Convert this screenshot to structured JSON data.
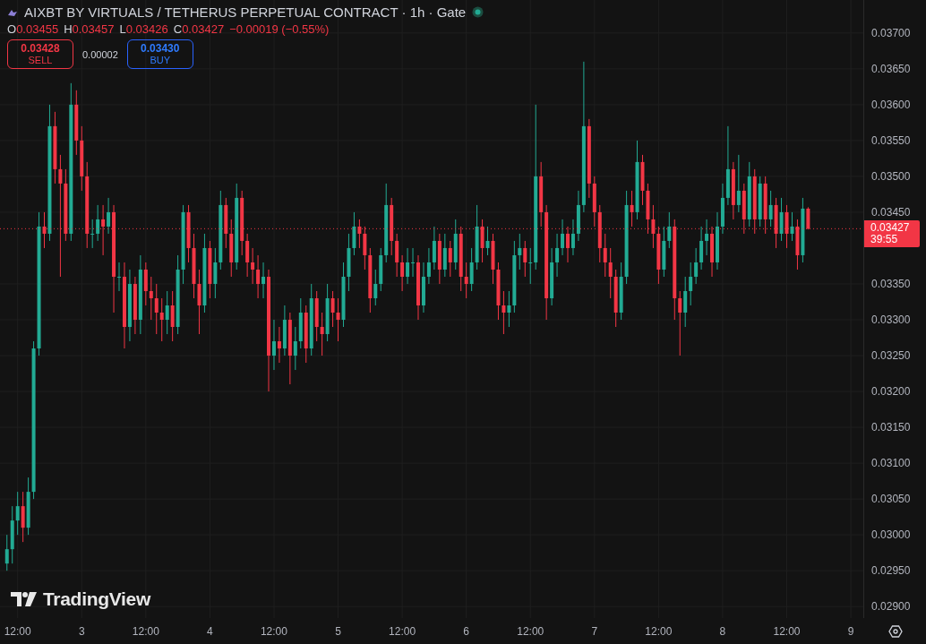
{
  "legend": {
    "title": "AIXBT BY VIRTUALS / TETHERUS PERPETUAL CONTRACT · 1h · Gate",
    "ohlc": [
      {
        "label": "O",
        "value": "0.03455"
      },
      {
        "label": "H",
        "value": "0.03457"
      },
      {
        "label": "L",
        "value": "0.03426"
      },
      {
        "label": "C",
        "value": "0.03427"
      }
    ],
    "change": "−0.00019 (−0.55%)",
    "trade": {
      "sell": {
        "price": "0.03428",
        "label": "SELL"
      },
      "spread": "0.00002",
      "buy": {
        "price": "0.03430",
        "label": "BUY"
      }
    }
  },
  "last_price": {
    "value": "0.03427",
    "countdown": "39:55"
  },
  "watermark_logo": {
    "text": "TradingView"
  },
  "chart_data": {
    "type": "candlestick",
    "ylim": [
      0.02884,
      0.03746
    ],
    "grid": true,
    "ref_lines": [
      {
        "axis": "y",
        "value": 0.03427,
        "color": "#f23645"
      }
    ],
    "categories": [
      null,
      null,
      "12:00",
      null,
      null,
      null,
      null,
      null,
      null,
      null,
      null,
      null,
      null,
      null,
      "3",
      null,
      null,
      null,
      null,
      null,
      null,
      null,
      null,
      null,
      null,
      null,
      "12:00",
      null,
      null,
      null,
      null,
      null,
      null,
      null,
      null,
      null,
      null,
      null,
      "4",
      null,
      null,
      null,
      null,
      null,
      null,
      null,
      null,
      null,
      null,
      null,
      "12:00",
      null,
      null,
      null,
      null,
      null,
      null,
      null,
      null,
      null,
      null,
      null,
      "5",
      null,
      null,
      null,
      null,
      null,
      null,
      null,
      null,
      null,
      null,
      null,
      "12:00",
      null,
      null,
      null,
      null,
      null,
      null,
      null,
      null,
      null,
      null,
      null,
      "6",
      null,
      null,
      null,
      null,
      null,
      null,
      null,
      null,
      null,
      null,
      null,
      "12:00",
      null,
      null,
      null,
      null,
      null,
      null,
      null,
      null,
      null,
      null,
      null,
      "7",
      null,
      null,
      null,
      null,
      null,
      null,
      null,
      null,
      null,
      null,
      null,
      "12:00",
      null,
      null,
      null,
      null,
      null,
      null,
      null,
      null,
      null,
      null,
      null,
      "8",
      null,
      null,
      null,
      null,
      null,
      null,
      null,
      null,
      null,
      null,
      null,
      "12:00",
      null,
      null,
      null,
      null,
      null,
      null,
      null,
      null,
      null,
      null,
      null,
      "9"
    ],
    "yticks": [
      {
        "value": 0.037,
        "label": "0.03700"
      },
      {
        "value": 0.0365,
        "label": "0.03650"
      },
      {
        "value": 0.036,
        "label": "0.03600"
      },
      {
        "value": 0.0355,
        "label": "0.03550"
      },
      {
        "value": 0.035,
        "label": "0.03500"
      },
      {
        "value": 0.0345,
        "label": "0.03450"
      },
      {
        "value": 0.0335,
        "label": "0.03350"
      },
      {
        "value": 0.033,
        "label": "0.03300"
      },
      {
        "value": 0.0325,
        "label": "0.03250"
      },
      {
        "value": 0.032,
        "label": "0.03200"
      },
      {
        "value": 0.0315,
        "label": "0.03150"
      },
      {
        "value": 0.031,
        "label": "0.03100"
      },
      {
        "value": 0.0305,
        "label": "0.03050"
      },
      {
        "value": 0.03,
        "label": "0.03000"
      },
      {
        "value": 0.0295,
        "label": "0.02950"
      },
      {
        "value": 0.029,
        "label": "0.02900"
      }
    ],
    "ohlc": [
      [
        0.0296,
        0.03,
        0.0295,
        0.0298
      ],
      [
        0.0298,
        0.0304,
        0.0296,
        0.0302
      ],
      [
        0.0302,
        0.0306,
        0.03,
        0.0304
      ],
      [
        0.0304,
        0.0306,
        0.0299,
        0.0301
      ],
      [
        0.0301,
        0.0308,
        0.03,
        0.0306
      ],
      [
        0.0306,
        0.0327,
        0.0305,
        0.0326
      ],
      [
        0.0326,
        0.0345,
        0.0325,
        0.0343
      ],
      [
        0.0343,
        0.0345,
        0.034,
        0.0342
      ],
      [
        0.0342,
        0.036,
        0.0341,
        0.0357
      ],
      [
        0.0357,
        0.0359,
        0.0349,
        0.0351
      ],
      [
        0.0351,
        0.0353,
        0.0336,
        0.0349
      ],
      [
        0.0349,
        0.0351,
        0.0341,
        0.0342
      ],
      [
        0.0342,
        0.0363,
        0.0341,
        0.036
      ],
      [
        0.036,
        0.0362,
        0.0353,
        0.0355
      ],
      [
        0.0355,
        0.0357,
        0.0348,
        0.035
      ],
      [
        0.035,
        0.0352,
        0.034,
        0.0342
      ],
      [
        0.0342,
        0.0344,
        0.034,
        0.0342
      ],
      [
        0.0342,
        0.0346,
        0.0341,
        0.0344
      ],
      [
        0.0344,
        0.0346,
        0.0339,
        0.0343
      ],
      [
        0.0343,
        0.0347,
        0.0342,
        0.0345
      ],
      [
        0.0345,
        0.0346,
        0.0331,
        0.0336
      ],
      [
        0.0336,
        0.0338,
        0.0334,
        0.0336
      ],
      [
        0.0336,
        0.0338,
        0.0326,
        0.0329
      ],
      [
        0.0329,
        0.0337,
        0.0327,
        0.0335
      ],
      [
        0.0335,
        0.0336,
        0.0328,
        0.033
      ],
      [
        0.033,
        0.0339,
        0.0328,
        0.0337
      ],
      [
        0.0337,
        0.0338,
        0.0332,
        0.0334
      ],
      [
        0.0334,
        0.0336,
        0.033,
        0.0333
      ],
      [
        0.0333,
        0.0335,
        0.0328,
        0.0331
      ],
      [
        0.0331,
        0.0333,
        0.0327,
        0.033
      ],
      [
        0.033,
        0.0334,
        0.0328,
        0.0332
      ],
      [
        0.0332,
        0.0334,
        0.0327,
        0.0329
      ],
      [
        0.0329,
        0.0339,
        0.0328,
        0.0337
      ],
      [
        0.0337,
        0.0346,
        0.0335,
        0.0345
      ],
      [
        0.0345,
        0.0346,
        0.0338,
        0.034
      ],
      [
        0.034,
        0.0342,
        0.0333,
        0.0335
      ],
      [
        0.0335,
        0.0337,
        0.0328,
        0.0332
      ],
      [
        0.0332,
        0.0342,
        0.0331,
        0.034
      ],
      [
        0.034,
        0.0341,
        0.0333,
        0.0335
      ],
      [
        0.0335,
        0.034,
        0.0333,
        0.0338
      ],
      [
        0.0338,
        0.0348,
        0.0337,
        0.0346
      ],
      [
        0.0346,
        0.0347,
        0.034,
        0.0342
      ],
      [
        0.0342,
        0.0344,
        0.0336,
        0.0338
      ],
      [
        0.0338,
        0.0349,
        0.0337,
        0.0347
      ],
      [
        0.0347,
        0.0348,
        0.0339,
        0.0341
      ],
      [
        0.0341,
        0.0342,
        0.0336,
        0.0338
      ],
      [
        0.0338,
        0.034,
        0.0335,
        0.0337
      ],
      [
        0.0337,
        0.0339,
        0.0333,
        0.0335
      ],
      [
        0.0335,
        0.0338,
        0.0333,
        0.0336
      ],
      [
        0.0336,
        0.0337,
        0.032,
        0.0325
      ],
      [
        0.0325,
        0.033,
        0.0323,
        0.0327
      ],
      [
        0.0327,
        0.0329,
        0.0324,
        0.0326
      ],
      [
        0.0326,
        0.0332,
        0.0325,
        0.033
      ],
      [
        0.033,
        0.0331,
        0.0321,
        0.0325
      ],
      [
        0.0325,
        0.0329,
        0.0323,
        0.0327
      ],
      [
        0.0327,
        0.0333,
        0.0326,
        0.0331
      ],
      [
        0.0331,
        0.0332,
        0.0324,
        0.0326
      ],
      [
        0.0326,
        0.0335,
        0.0325,
        0.0333
      ],
      [
        0.0333,
        0.0334,
        0.0327,
        0.0329
      ],
      [
        0.0329,
        0.0331,
        0.0325,
        0.0328
      ],
      [
        0.0328,
        0.0335,
        0.0327,
        0.0333
      ],
      [
        0.0333,
        0.0334,
        0.0329,
        0.0331
      ],
      [
        0.0331,
        0.0333,
        0.0327,
        0.033
      ],
      [
        0.033,
        0.0338,
        0.0329,
        0.0336
      ],
      [
        0.0336,
        0.0342,
        0.0334,
        0.034
      ],
      [
        0.034,
        0.0345,
        0.0339,
        0.0343
      ],
      [
        0.0343,
        0.0344,
        0.034,
        0.0342
      ],
      [
        0.0342,
        0.0343,
        0.0337,
        0.0339
      ],
      [
        0.0339,
        0.034,
        0.0331,
        0.0333
      ],
      [
        0.0333,
        0.0337,
        0.0332,
        0.0335
      ],
      [
        0.0335,
        0.034,
        0.0334,
        0.0339
      ],
      [
        0.0339,
        0.0349,
        0.0338,
        0.0346
      ],
      [
        0.0346,
        0.0347,
        0.0339,
        0.0341
      ],
      [
        0.0341,
        0.0342,
        0.0336,
        0.0338
      ],
      [
        0.0338,
        0.0339,
        0.0334,
        0.0336
      ],
      [
        0.0336,
        0.034,
        0.0335,
        0.0338
      ],
      [
        0.0338,
        0.034,
        0.0336,
        0.0338
      ],
      [
        0.0338,
        0.0339,
        0.033,
        0.0332
      ],
      [
        0.0332,
        0.0338,
        0.0331,
        0.0336
      ],
      [
        0.0336,
        0.034,
        0.0335,
        0.0338
      ],
      [
        0.0338,
        0.0343,
        0.0337,
        0.0341
      ],
      [
        0.0341,
        0.0342,
        0.0335,
        0.0337
      ],
      [
        0.0337,
        0.0342,
        0.0336,
        0.034
      ],
      [
        0.034,
        0.0341,
        0.0336,
        0.0338
      ],
      [
        0.0338,
        0.0344,
        0.0337,
        0.0342
      ],
      [
        0.0342,
        0.0343,
        0.0334,
        0.0336
      ],
      [
        0.0336,
        0.0338,
        0.0333,
        0.0335
      ],
      [
        0.0335,
        0.034,
        0.0334,
        0.0338
      ],
      [
        0.0338,
        0.0346,
        0.0337,
        0.0343
      ],
      [
        0.0343,
        0.0344,
        0.0338,
        0.034
      ],
      [
        0.034,
        0.0343,
        0.0339,
        0.0341
      ],
      [
        0.0341,
        0.0342,
        0.0335,
        0.0337
      ],
      [
        0.0337,
        0.0338,
        0.033,
        0.0332
      ],
      [
        0.0332,
        0.0334,
        0.0328,
        0.0331
      ],
      [
        0.0331,
        0.0334,
        0.0329,
        0.0332
      ],
      [
        0.0332,
        0.0341,
        0.0331,
        0.0339
      ],
      [
        0.0339,
        0.0342,
        0.0337,
        0.034
      ],
      [
        0.034,
        0.0341,
        0.0336,
        0.0338
      ],
      [
        0.0338,
        0.034,
        0.0335,
        0.0338
      ],
      [
        0.0338,
        0.036,
        0.0337,
        0.035
      ],
      [
        0.035,
        0.0352,
        0.0343,
        0.0345
      ],
      [
        0.0345,
        0.0346,
        0.033,
        0.0333
      ],
      [
        0.0333,
        0.034,
        0.0332,
        0.0338
      ],
      [
        0.0338,
        0.0342,
        0.0336,
        0.034
      ],
      [
        0.034,
        0.0344,
        0.0339,
        0.0342
      ],
      [
        0.0342,
        0.0343,
        0.0338,
        0.034
      ],
      [
        0.034,
        0.0344,
        0.0339,
        0.0342
      ],
      [
        0.0342,
        0.0348,
        0.0341,
        0.0346
      ],
      [
        0.0346,
        0.0366,
        0.0345,
        0.0357
      ],
      [
        0.0357,
        0.0358,
        0.0347,
        0.0349
      ],
      [
        0.0349,
        0.035,
        0.0343,
        0.0345
      ],
      [
        0.0345,
        0.0346,
        0.0338,
        0.034
      ],
      [
        0.034,
        0.0342,
        0.0336,
        0.0338
      ],
      [
        0.0338,
        0.034,
        0.0333,
        0.0336
      ],
      [
        0.0336,
        0.0337,
        0.0329,
        0.0331
      ],
      [
        0.0331,
        0.0338,
        0.033,
        0.0336
      ],
      [
        0.0336,
        0.0348,
        0.0335,
        0.0346
      ],
      [
        0.0346,
        0.0348,
        0.0343,
        0.0345
      ],
      [
        0.0345,
        0.0355,
        0.0344,
        0.0352
      ],
      [
        0.0352,
        0.0353,
        0.0346,
        0.0348
      ],
      [
        0.0348,
        0.0349,
        0.0342,
        0.0344
      ],
      [
        0.0344,
        0.0346,
        0.034,
        0.0342
      ],
      [
        0.0342,
        0.0343,
        0.0335,
        0.0337
      ],
      [
        0.0337,
        0.0343,
        0.0336,
        0.0341
      ],
      [
        0.0341,
        0.0345,
        0.034,
        0.0343
      ],
      [
        0.0343,
        0.0344,
        0.033,
        0.0333
      ],
      [
        0.0333,
        0.0334,
        0.0325,
        0.0331
      ],
      [
        0.0331,
        0.0336,
        0.0329,
        0.0334
      ],
      [
        0.0334,
        0.0338,
        0.0332,
        0.0336
      ],
      [
        0.0336,
        0.034,
        0.0335,
        0.0338
      ],
      [
        0.0338,
        0.0343,
        0.0337,
        0.0341
      ],
      [
        0.0341,
        0.0344,
        0.0339,
        0.0342
      ],
      [
        0.0342,
        0.0343,
        0.0336,
        0.0338
      ],
      [
        0.0338,
        0.0345,
        0.0337,
        0.0343
      ],
      [
        0.0343,
        0.0349,
        0.0342,
        0.0347
      ],
      [
        0.0347,
        0.0357,
        0.0346,
        0.0351
      ],
      [
        0.0351,
        0.0352,
        0.0344,
        0.0346
      ],
      [
        0.0346,
        0.0353,
        0.0345,
        0.0348
      ],
      [
        0.0348,
        0.0349,
        0.0342,
        0.0344
      ],
      [
        0.0344,
        0.0352,
        0.0343,
        0.035
      ],
      [
        0.035,
        0.0351,
        0.0342,
        0.0344
      ],
      [
        0.0344,
        0.035,
        0.0343,
        0.0349
      ],
      [
        0.0349,
        0.035,
        0.0342,
        0.0344
      ],
      [
        0.0344,
        0.0348,
        0.0343,
        0.0346
      ],
      [
        0.0346,
        0.0347,
        0.034,
        0.0342
      ],
      [
        0.0342,
        0.0347,
        0.0341,
        0.0345
      ],
      [
        0.0345,
        0.0346,
        0.034,
        0.0342
      ],
      [
        0.0342,
        0.0345,
        0.0341,
        0.0343
      ],
      [
        0.0343,
        0.0344,
        0.0337,
        0.0339
      ],
      [
        0.0339,
        0.0347,
        0.0338,
        0.03455
      ],
      [
        0.03455,
        0.03457,
        0.03426,
        0.03427
      ],
      null,
      null,
      null,
      null,
      null,
      null,
      null,
      null
    ]
  }
}
